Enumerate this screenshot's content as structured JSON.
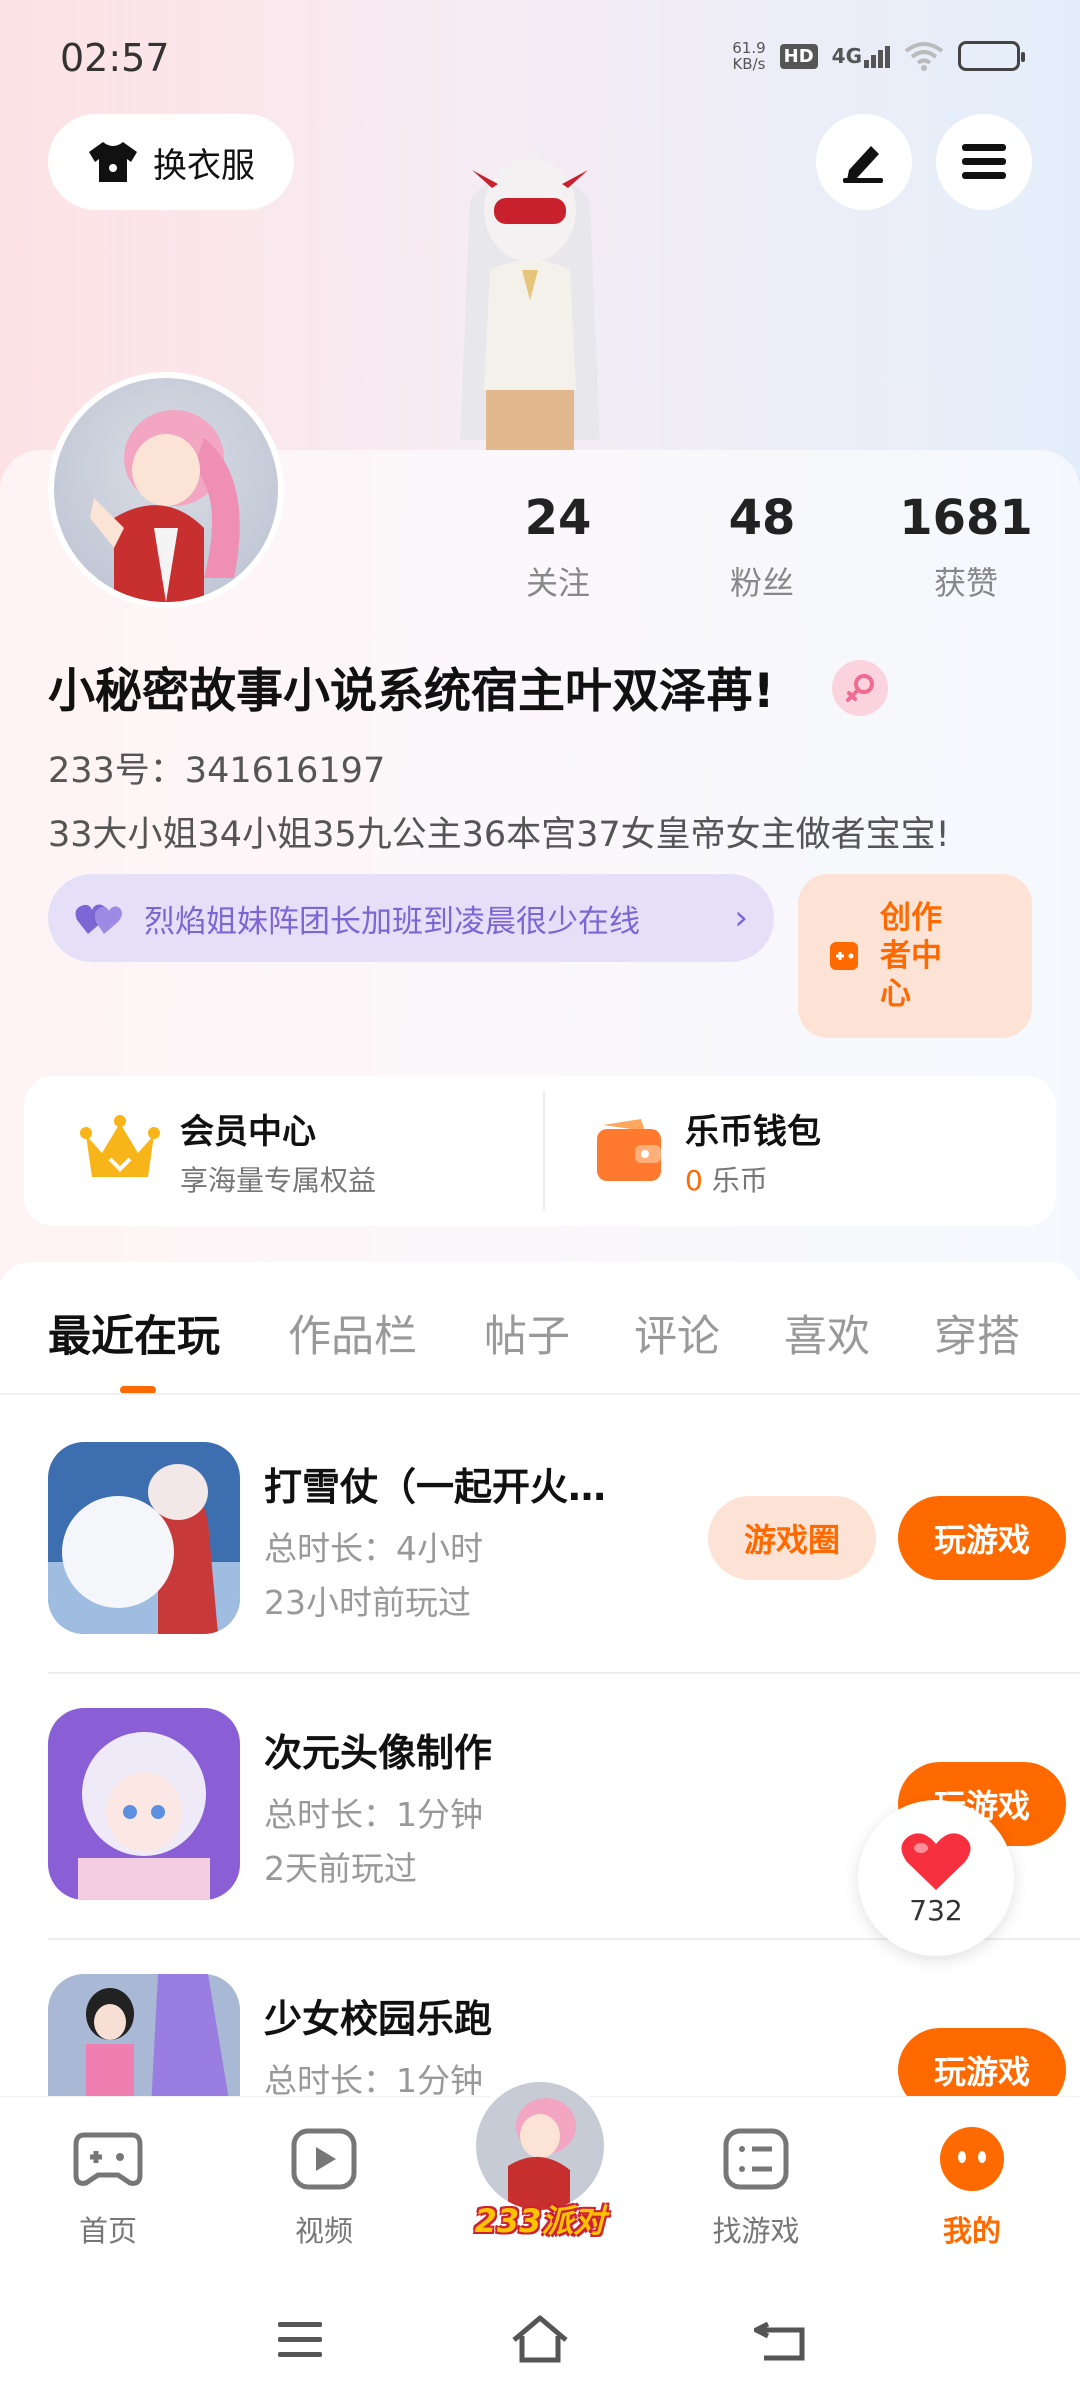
{
  "status": {
    "time": "02:57",
    "net_speed": "61.9",
    "net_unit": "KB/s",
    "hd": "HD",
    "network": "4G"
  },
  "header": {
    "dress_button": "换衣服"
  },
  "stats": [
    {
      "value": "24",
      "label": "关注"
    },
    {
      "value": "48",
      "label": "粉丝"
    },
    {
      "value": "1681",
      "label": "获赞"
    }
  ],
  "profile": {
    "nickname": "小秘密故事小说系统宿主叶双泽苒!",
    "uid": "233号：341616197",
    "bio": "33大小姐34小姐35九公主36本宫37女皇帝女主做者宝宝!",
    "team": "烈焰姐妹阵团长加班到凌晨很少在线",
    "creator_center": "创作者中心"
  },
  "member": {
    "title": "会员中心",
    "subtitle": "享海量专属权益"
  },
  "wallet": {
    "title": "乐币钱包",
    "amount": "0",
    "unit": "乐币"
  },
  "tabs": [
    "最近在玩",
    "作品栏",
    "帖子",
    "评论",
    "喜欢",
    "穿搭"
  ],
  "games": [
    {
      "name": "打雪仗（一起开火…",
      "duration": "总时长：4小时",
      "last": "23小时前玩过",
      "circle": "游戏圈",
      "play": "玩游戏"
    },
    {
      "name": "次元头像制作",
      "duration": "总时长：1分钟",
      "last": "2天前玩过",
      "play": "玩游戏"
    },
    {
      "name": "少女校园乐跑",
      "duration": "总时长：1分钟",
      "play": "玩游戏"
    }
  ],
  "like_count": "732",
  "nav": {
    "home": "首页",
    "video": "视频",
    "party": "233派对",
    "find": "找游戏",
    "mine": "我的"
  },
  "colors": {
    "accent": "#ff6a00",
    "team": "#7b66d4"
  }
}
